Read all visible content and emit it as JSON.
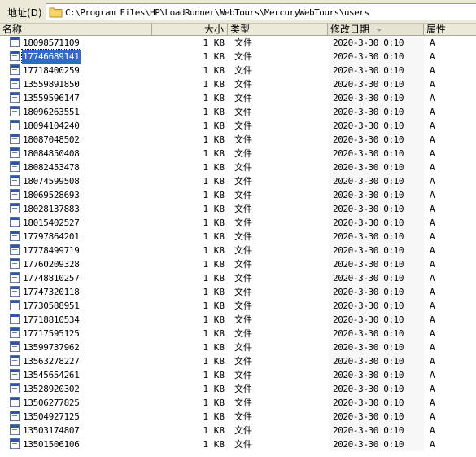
{
  "address_bar": {
    "label": "地址(D)",
    "path": "C:\\Program Files\\HP\\LoadRunner\\WebTours\\MercuryWebTours\\users",
    "folder_icon": "folder-icon"
  },
  "columns": {
    "name": "名称",
    "size": "大小",
    "type": "类型",
    "modified": "修改日期",
    "attributes": "属性"
  },
  "colors": {
    "selection": "#316ac5",
    "header_bg": "#ece9d8"
  },
  "files": [
    {
      "name": "18098571109",
      "size": "1 KB",
      "type": "文件",
      "date": "2020-3-30 0:10",
      "attr": "A"
    },
    {
      "name": "17746689141",
      "size": "1 KB",
      "type": "文件",
      "date": "2020-3-30 0:10",
      "attr": "A",
      "selected": true
    },
    {
      "name": "17718400259",
      "size": "1 KB",
      "type": "文件",
      "date": "2020-3-30 0:10",
      "attr": "A"
    },
    {
      "name": "13559891850",
      "size": "1 KB",
      "type": "文件",
      "date": "2020-3-30 0:10",
      "attr": "A"
    },
    {
      "name": "13559596147",
      "size": "1 KB",
      "type": "文件",
      "date": "2020-3-30 0:10",
      "attr": "A"
    },
    {
      "name": "18096263551",
      "size": "1 KB",
      "type": "文件",
      "date": "2020-3-30 0:10",
      "attr": "A"
    },
    {
      "name": "18094104240",
      "size": "1 KB",
      "type": "文件",
      "date": "2020-3-30 0:10",
      "attr": "A"
    },
    {
      "name": "18087048502",
      "size": "1 KB",
      "type": "文件",
      "date": "2020-3-30 0:10",
      "attr": "A"
    },
    {
      "name": "18084850408",
      "size": "1 KB",
      "type": "文件",
      "date": "2020-3-30 0:10",
      "attr": "A"
    },
    {
      "name": "18082453478",
      "size": "1 KB",
      "type": "文件",
      "date": "2020-3-30 0:10",
      "attr": "A"
    },
    {
      "name": "18074599508",
      "size": "1 KB",
      "type": "文件",
      "date": "2020-3-30 0:10",
      "attr": "A"
    },
    {
      "name": "18069528693",
      "size": "1 KB",
      "type": "文件",
      "date": "2020-3-30 0:10",
      "attr": "A"
    },
    {
      "name": "18028137883",
      "size": "1 KB",
      "type": "文件",
      "date": "2020-3-30 0:10",
      "attr": "A"
    },
    {
      "name": "18015402527",
      "size": "1 KB",
      "type": "文件",
      "date": "2020-3-30 0:10",
      "attr": "A"
    },
    {
      "name": "17797864201",
      "size": "1 KB",
      "type": "文件",
      "date": "2020-3-30 0:10",
      "attr": "A"
    },
    {
      "name": "17778499719",
      "size": "1 KB",
      "type": "文件",
      "date": "2020-3-30 0:10",
      "attr": "A"
    },
    {
      "name": "17760209328",
      "size": "1 KB",
      "type": "文件",
      "date": "2020-3-30 0:10",
      "attr": "A"
    },
    {
      "name": "17748810257",
      "size": "1 KB",
      "type": "文件",
      "date": "2020-3-30 0:10",
      "attr": "A"
    },
    {
      "name": "17747320118",
      "size": "1 KB",
      "type": "文件",
      "date": "2020-3-30 0:10",
      "attr": "A"
    },
    {
      "name": "17730588951",
      "size": "1 KB",
      "type": "文件",
      "date": "2020-3-30 0:10",
      "attr": "A"
    },
    {
      "name": "17718810534",
      "size": "1 KB",
      "type": "文件",
      "date": "2020-3-30 0:10",
      "attr": "A"
    },
    {
      "name": "17717595125",
      "size": "1 KB",
      "type": "文件",
      "date": "2020-3-30 0:10",
      "attr": "A"
    },
    {
      "name": "13599737962",
      "size": "1 KB",
      "type": "文件",
      "date": "2020-3-30 0:10",
      "attr": "A"
    },
    {
      "name": "13563278227",
      "size": "1 KB",
      "type": "文件",
      "date": "2020-3-30 0:10",
      "attr": "A"
    },
    {
      "name": "13545654261",
      "size": "1 KB",
      "type": "文件",
      "date": "2020-3-30 0:10",
      "attr": "A"
    },
    {
      "name": "13528920302",
      "size": "1 KB",
      "type": "文件",
      "date": "2020-3-30 0:10",
      "attr": "A"
    },
    {
      "name": "13506277825",
      "size": "1 KB",
      "type": "文件",
      "date": "2020-3-30 0:10",
      "attr": "A"
    },
    {
      "name": "13504927125",
      "size": "1 KB",
      "type": "文件",
      "date": "2020-3-30 0:10",
      "attr": "A"
    },
    {
      "name": "13503174807",
      "size": "1 KB",
      "type": "文件",
      "date": "2020-3-30 0:10",
      "attr": "A"
    },
    {
      "name": "13501506106",
      "size": "1 KB",
      "type": "文件",
      "date": "2020-3-30 0:10",
      "attr": "A"
    }
  ]
}
